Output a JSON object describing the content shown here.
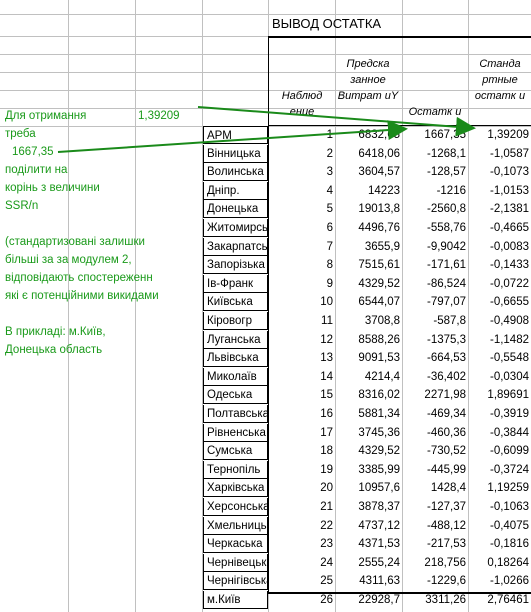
{
  "sheet_title": "ВЫВОД ОСТАТКА",
  "headers": {
    "observation": "Наблюд ение",
    "predicted": "Предска занное Витрат иY",
    "residual": "Остатк и",
    "std_residual": "Станда ртные остатк и"
  },
  "notes": {
    "line1": "Для отримання",
    "value1": "1,39209",
    "line2": "треба",
    "value2": "1667,35",
    "line3": "поділити на",
    "line4": "корінь з величини",
    "line5": "SSR/n",
    "line6": "(стандартизовані залишки",
    "line7": " більші за за модулем 2,",
    "line8": "відповідають спостереженн",
    "line9": "які є потенційними викидами",
    "line10": "В прикладі: м.Київ,",
    "line11": "Донецька область"
  },
  "rows": [
    {
      "region": "АРМ",
      "obs": "1",
      "pred": "6832,65",
      "resid": "1667,35",
      "std": "1,39209"
    },
    {
      "region": "Вінницька",
      "obs": "2",
      "pred": "6418,06",
      "resid": "-1268,1",
      "std": "-1,0587"
    },
    {
      "region": "Волинська",
      "obs": "3",
      "pred": "3604,57",
      "resid": "-128,57",
      "std": "-0,1073"
    },
    {
      "region": "Дніпр.",
      "obs": "4",
      "pred": "14223",
      "resid": "-1216",
      "std": "-1,0153"
    },
    {
      "region": "Донецька",
      "obs": "5",
      "pred": "19013,8",
      "resid": "-2560,8",
      "std": "-2,1381"
    },
    {
      "region": "Житомирська",
      "obs": "6",
      "pred": "4496,76",
      "resid": "-558,76",
      "std": "-0,4665"
    },
    {
      "region": "Закарпатська",
      "obs": "7",
      "pred": "3655,9",
      "resid": "-9,9042",
      "std": "-0,0083"
    },
    {
      "region": "Запорізька",
      "obs": "8",
      "pred": "7515,61",
      "resid": "-171,61",
      "std": "-0,1433"
    },
    {
      "region": "Ів-Франк",
      "obs": "9",
      "pred": "4329,52",
      "resid": "-86,524",
      "std": "-0,0722"
    },
    {
      "region": "Київська",
      "obs": "10",
      "pred": "6544,07",
      "resid": "-797,07",
      "std": "-0,6655"
    },
    {
      "region": "Кіровогр",
      "obs": "11",
      "pred": "3708,8",
      "resid": "-587,8",
      "std": "-0,4908"
    },
    {
      "region": "Луганська",
      "obs": "12",
      "pred": "8588,26",
      "resid": "-1375,3",
      "std": "-1,1482"
    },
    {
      "region": "Львівська",
      "obs": "13",
      "pred": "9091,53",
      "resid": "-664,53",
      "std": "-0,5548"
    },
    {
      "region": "Миколаїв",
      "obs": "14",
      "pred": "4214,4",
      "resid": "-36,402",
      "std": "-0,0304"
    },
    {
      "region": "Одеська",
      "obs": "15",
      "pred": "8316,02",
      "resid": "2271,98",
      "std": "1,89691"
    },
    {
      "region": "Полтавська",
      "obs": "16",
      "pred": "5881,34",
      "resid": "-469,34",
      "std": "-0,3919"
    },
    {
      "region": "Рівненська",
      "obs": "17",
      "pred": "3745,36",
      "resid": "-460,36",
      "std": "-0,3844"
    },
    {
      "region": "Сумська",
      "obs": "18",
      "pred": "4329,52",
      "resid": "-730,52",
      "std": "-0,6099"
    },
    {
      "region": "Тернопіль",
      "obs": "19",
      "pred": "3385,99",
      "resid": "-445,99",
      "std": "-0,3724"
    },
    {
      "region": "Харківська",
      "obs": "20",
      "pred": "10957,6",
      "resid": "1428,4",
      "std": "1,19259"
    },
    {
      "region": "Херсонська",
      "obs": "21",
      "pred": "3878,37",
      "resid": "-127,37",
      "std": "-0,1063"
    },
    {
      "region": "Хмельницька",
      "obs": "22",
      "pred": "4737,12",
      "resid": "-488,12",
      "std": "-0,4075"
    },
    {
      "region": "Черкаська",
      "obs": "23",
      "pred": "4371,53",
      "resid": "-217,53",
      "std": "-0,1816"
    },
    {
      "region": "Чернівецька",
      "obs": "24",
      "pred": "2555,24",
      "resid": "218,756",
      "std": "0,18264"
    },
    {
      "region": "Чернігівська",
      "obs": "25",
      "pred": "4311,63",
      "resid": "-1229,6",
      "std": "-1,0266"
    },
    {
      "region": "м.Київ",
      "obs": "26",
      "pred": "22928,7",
      "resid": "3311,26",
      "std": "2,76461"
    }
  ],
  "colors": {
    "note_green": "#1a9a1a",
    "grid": "#c0c0c0",
    "arrow_green": "#1a8a1a"
  }
}
